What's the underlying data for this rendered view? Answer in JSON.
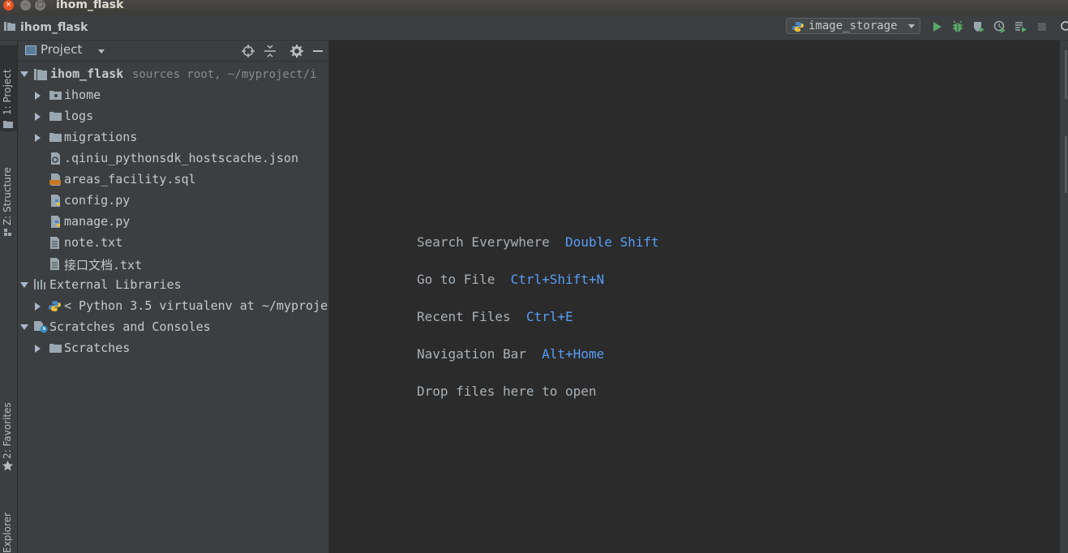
{
  "window": {
    "title": "ihom_flask",
    "close": "×",
    "minimize": "–",
    "maximize": "□"
  },
  "navbar": {
    "project_name": "ihom_flask"
  },
  "run_config": {
    "selected": "image_storage"
  },
  "toolbar": {
    "icons": [
      "run-icon",
      "debug-icon",
      "coverage-icon",
      "profile-icon",
      "concurrency-icon",
      "stop-icon",
      "search-icon"
    ]
  },
  "left_tabs": {
    "project": "1: Project",
    "structure": "Z: Structure",
    "favorites": "2: Favorites",
    "explorer": "Explorer"
  },
  "project_panel": {
    "title": "Project",
    "tree": {
      "root": {
        "name": "ihom_flask",
        "note": "sources root, ~/myproject/i"
      },
      "ihome": "ihome",
      "logs": "logs",
      "migrations": "migrations",
      "hostscache": ".qiniu_pythonsdk_hostscache.json",
      "sql": "areas_facility.sql",
      "config": "config.py",
      "manage": "manage.py",
      "note": "note.txt",
      "api_doc": "接口文档.txt",
      "external": "External Libraries",
      "python_env": "< Python 3.5 virtualenv at ~/myproje",
      "scratches_consoles": "Scratches and Consoles",
      "scratches": "Scratches"
    }
  },
  "editor_hints": {
    "search": {
      "label": "Search Everywhere",
      "shortcut": "Double Shift"
    },
    "goto": {
      "label": "Go to File",
      "shortcut": "Ctrl+Shift+N"
    },
    "recent": {
      "label": "Recent Files",
      "shortcut": "Ctrl+E"
    },
    "navbar": {
      "label": "Navigation Bar",
      "shortcut": "Alt+Home"
    },
    "drop": "Drop files here to open"
  },
  "colors": {
    "accent": "#589df6",
    "background": "#2b2b2b",
    "panel": "#3c3f41",
    "run_green": "#59a869"
  }
}
